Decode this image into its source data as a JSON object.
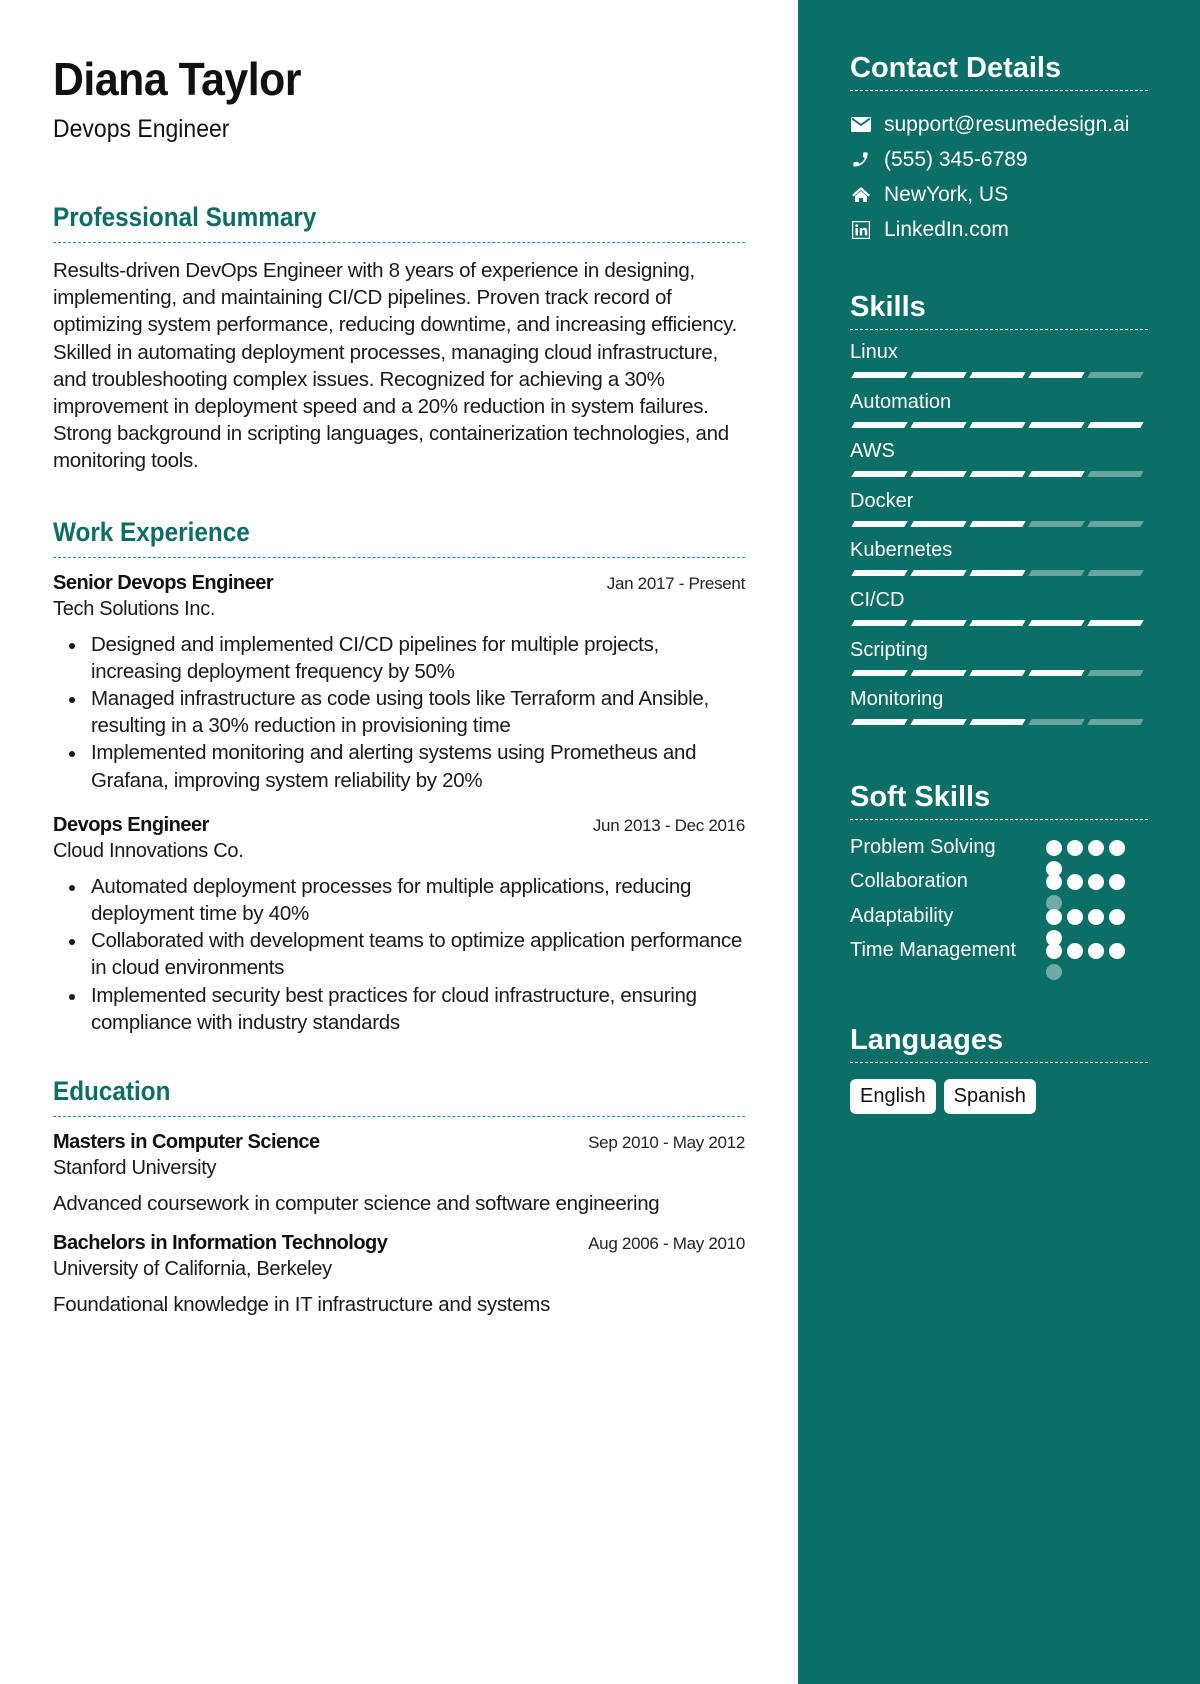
{
  "header": {
    "name": "Diana Taylor",
    "role": "Devops Engineer"
  },
  "colors": {
    "accent": "#0e6e66",
    "sidebar_bg": "#0b6e67",
    "text": "#1a1a1a"
  },
  "summary": {
    "title": "Professional Summary",
    "text": "Results-driven DevOps Engineer with 8 years of experience in designing, implementing, and maintaining CI/CD pipelines. Proven track record of optimizing system performance, reducing downtime, and increasing efficiency. Skilled in automating deployment processes, managing cloud infrastructure, and troubleshooting complex issues. Recognized for achieving a 30% improvement in deployment speed and a 20% reduction in system failures. Strong background in scripting languages, containerization technologies, and monitoring tools."
  },
  "work": {
    "title": "Work Experience",
    "jobs": [
      {
        "title": "Senior Devops Engineer",
        "dates": "Jan 2017 - Present",
        "company": "Tech Solutions Inc.",
        "bullets": [
          "Designed and implemented CI/CD pipelines for multiple projects, increasing deployment frequency by 50%",
          "Managed infrastructure as code using tools like Terraform and Ansible, resulting in a 30% reduction in provisioning time",
          "Implemented monitoring and alerting systems using Prometheus and Grafana, improving system reliability by 20%"
        ]
      },
      {
        "title": "Devops Engineer",
        "dates": "Jun 2013 - Dec 2016",
        "company": "Cloud Innovations Co.",
        "bullets": [
          "Automated deployment processes for multiple applications, reducing deployment time by 40%",
          "Collaborated with development teams to optimize application performance in cloud environments",
          "Implemented security best practices for cloud infrastructure, ensuring compliance with industry standards"
        ]
      }
    ]
  },
  "education": {
    "title": "Education",
    "items": [
      {
        "degree": "Masters in Computer Science",
        "dates": "Sep 2010 - May 2012",
        "school": "Stanford University",
        "description": "Advanced coursework in computer science and software engineering"
      },
      {
        "degree": "Bachelors in Information Technology",
        "dates": "Aug 2006 - May 2010",
        "school": "University of California, Berkeley",
        "description": "Foundational knowledge in IT infrastructure and systems"
      }
    ]
  },
  "contact": {
    "title": "Contact Details",
    "items": [
      {
        "icon": "envelope-icon",
        "text": "support@resumedesign.ai"
      },
      {
        "icon": "phone-icon",
        "text": "(555) 345-6789"
      },
      {
        "icon": "home-icon",
        "text": "NewYork, US"
      },
      {
        "icon": "linkedin-icon",
        "text": "LinkedIn.com"
      }
    ]
  },
  "skills": {
    "title": "Skills",
    "max": 5,
    "items": [
      {
        "name": "Linux",
        "level": 4
      },
      {
        "name": "Automation",
        "level": 5
      },
      {
        "name": "AWS",
        "level": 4
      },
      {
        "name": "Docker",
        "level": 3
      },
      {
        "name": "Kubernetes",
        "level": 3
      },
      {
        "name": "CI/CD",
        "level": 5
      },
      {
        "name": "Scripting",
        "level": 4
      },
      {
        "name": "Monitoring",
        "level": 3
      }
    ]
  },
  "soft_skills": {
    "title": "Soft Skills",
    "max": 5,
    "items": [
      {
        "name": "Problem Solving",
        "level": 5
      },
      {
        "name": "Collaboration",
        "level": 4
      },
      {
        "name": "Adaptability",
        "level": 5
      },
      {
        "name": "Time Management",
        "level": 4
      }
    ]
  },
  "languages": {
    "title": "Languages",
    "items": [
      "English",
      "Spanish"
    ]
  }
}
